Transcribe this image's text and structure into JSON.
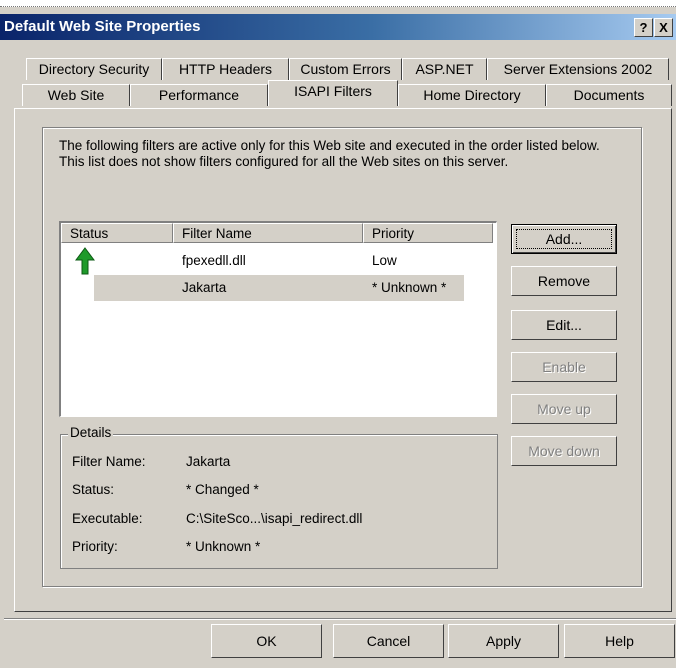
{
  "window": {
    "title": "Default Web Site Properties",
    "help_glyph": "?",
    "close_glyph": "X"
  },
  "tabs_row1": [
    {
      "label": "Directory Security"
    },
    {
      "label": "HTTP Headers"
    },
    {
      "label": "Custom Errors"
    },
    {
      "label": "ASP.NET"
    },
    {
      "label": "Server Extensions 2002"
    }
  ],
  "tabs_row2": [
    {
      "label": "Web Site"
    },
    {
      "label": "Performance"
    },
    {
      "label": "ISAPI Filters",
      "active": true
    },
    {
      "label": "Home Directory"
    },
    {
      "label": "Documents"
    }
  ],
  "description": "The following filters are active only for this Web site and executed in the order listed below. This list does not show filters configured for all the Web sites on this server.",
  "filter_list": {
    "columns": [
      "Status",
      "Filter Name",
      "Priority"
    ],
    "rows": [
      {
        "status_icon": "green-up-arrow-icon",
        "name": "fpexedll.dll",
        "priority": "Low"
      },
      {
        "status_icon": "",
        "name": "Jakarta",
        "priority": "* Unknown *",
        "selected": true
      }
    ]
  },
  "buttons": {
    "add": "Add...",
    "remove": "Remove",
    "edit": "Edit...",
    "enable": "Enable",
    "move_up": "Move up",
    "move_down": "Move down"
  },
  "details": {
    "legend": "Details",
    "filter_name_label": "Filter Name:",
    "filter_name_value": "Jakarta",
    "status_label": "Status:",
    "status_value": "* Changed *",
    "executable_label": "Executable:",
    "executable_value": "C:\\SiteSco...\\isapi_redirect.dll",
    "priority_label": "Priority:",
    "priority_value": "* Unknown *"
  },
  "dialog_buttons": {
    "ok": "OK",
    "cancel": "Cancel",
    "apply": "Apply",
    "help": "Help"
  },
  "colors": {
    "title_gradient_start": "#0a246a",
    "title_gradient_end": "#a6caf0",
    "dialog_face": "#d4d0c8",
    "status_arrow": "#1f9a2a"
  }
}
